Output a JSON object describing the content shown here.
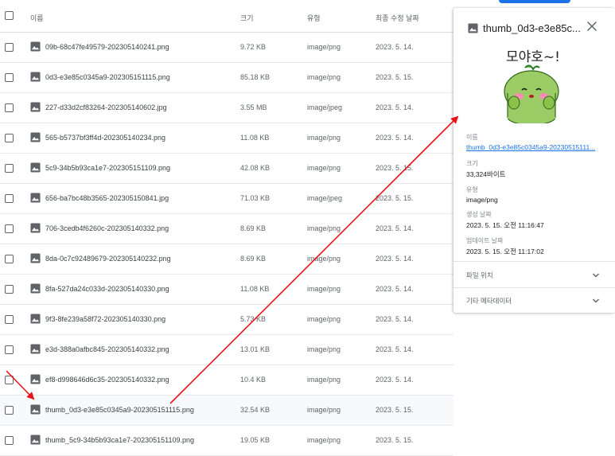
{
  "table": {
    "headers": {
      "name": "이름",
      "size": "크기",
      "type": "유형",
      "modified": "최종 수정 날짜"
    },
    "rows": [
      {
        "name": "09b-68c47fe49579-202305140241.png",
        "size": "9.72 KB",
        "type": "image/png",
        "date": "2023. 5. 14."
      },
      {
        "name": "0d3-e3e85c0345a9-202305151115.png",
        "size": "85.18 KB",
        "type": "image/png",
        "date": "2023. 5. 15."
      },
      {
        "name": "227-d33d2cf83264-202305140602.jpg",
        "size": "3.55 MB",
        "type": "image/jpeg",
        "date": "2023. 5. 14."
      },
      {
        "name": "565-b5737bf3ff4d-202305140234.png",
        "size": "11.08 KB",
        "type": "image/png",
        "date": "2023. 5. 14."
      },
      {
        "name": "5c9-34b5b93ca1e7-202305151109.png",
        "size": "42.08 KB",
        "type": "image/png",
        "date": "2023. 5. 15."
      },
      {
        "name": "656-ba7bc48b3565-202305150841.jpg",
        "size": "71.03 KB",
        "type": "image/jpeg",
        "date": "2023. 5. 15."
      },
      {
        "name": "706-3cedb4f6260c-202305140332.png",
        "size": "8.69 KB",
        "type": "image/png",
        "date": "2023. 5. 14."
      },
      {
        "name": "8da-0c7c92489679-202305140232.png",
        "size": "8.69 KB",
        "type": "image/png",
        "date": "2023. 5. 14."
      },
      {
        "name": "8fa-527da24c033d-202305140330.png",
        "size": "11.08 KB",
        "type": "image/png",
        "date": "2023. 5. 14."
      },
      {
        "name": "9f3-8fe239a58f72-202305140330.png",
        "size": "5.73 KB",
        "type": "image/png",
        "date": "2023. 5. 14."
      },
      {
        "name": "e3d-388a0afbc845-202305140332.png",
        "size": "13.01 KB",
        "type": "image/png",
        "date": "2023. 5. 14."
      },
      {
        "name": "ef8-d998646d6c35-202305140332.png",
        "size": "10.4 KB",
        "type": "image/png",
        "date": "2023. 5. 14."
      },
      {
        "name": "thumb_0d3-e3e85c0345a9-202305151115.png",
        "size": "32.54 KB",
        "type": "image/png",
        "date": "2023. 5. 15."
      },
      {
        "name": "thumb_5c9-34b5b93ca1e7-202305151109.png",
        "size": "19.05 KB",
        "type": "image/png",
        "date": "2023. 5. 15."
      }
    ]
  },
  "panel": {
    "title": "thumb_0d3-e3e85c...",
    "preview_text": "모야호~!",
    "name_label": "이름",
    "name_value": "thumb_0d3-e3e85c0345a9-20230515111...",
    "size_label": "크기",
    "size_value": "33,324바이트",
    "type_label": "유형",
    "type_value": "image/png",
    "created_label": "생성 날짜",
    "created_value": "2023. 5. 15. 오전 11:16:47",
    "updated_label": "업데이트 날짜",
    "updated_value": "2023. 5. 15. 오전 11:17:02",
    "section_location": "파일 위치",
    "section_metadata": "기타 메타데이터"
  },
  "colors": {
    "accent": "#1a73e8",
    "annotation": "#e8141c",
    "icon": "#5f6368"
  }
}
